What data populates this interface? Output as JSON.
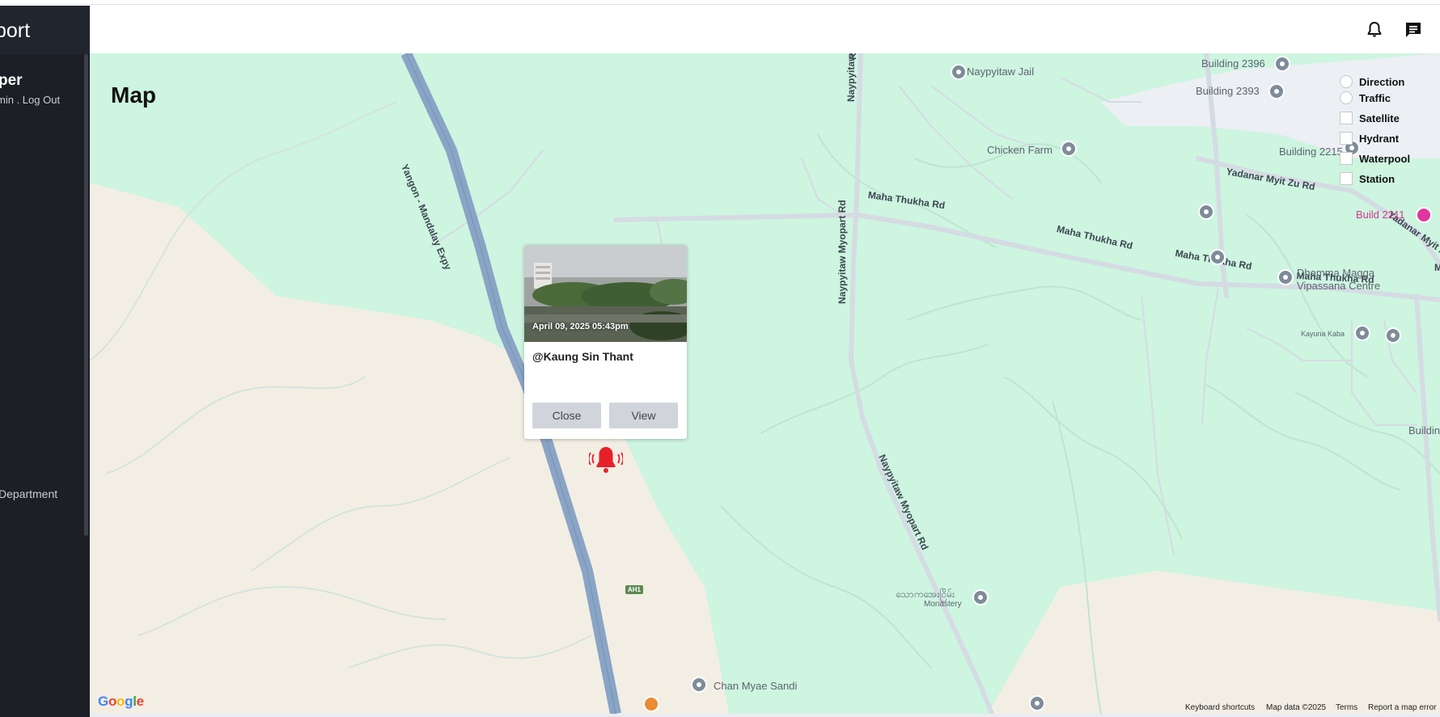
{
  "sidebar": {
    "brand": "port",
    "user_name": "per",
    "user_role": "min",
    "separator": " . ",
    "logout_label": "Log Out",
    "menu_item": "Department"
  },
  "header": {
    "notification_icon": "bell-icon",
    "messages_icon": "chat-icon"
  },
  "page": {
    "title": "Map"
  },
  "layers": [
    {
      "label": "Direction",
      "type": "radio",
      "checked": false
    },
    {
      "label": "Traffic",
      "type": "radio",
      "checked": false
    },
    {
      "label": "Satellite",
      "type": "checkbox",
      "checked": false
    },
    {
      "label": "Hydrant",
      "type": "checkbox",
      "checked": false
    },
    {
      "label": "Waterpool",
      "type": "checkbox",
      "checked": false
    },
    {
      "label": "Station",
      "type": "checkbox",
      "checked": false
    }
  ],
  "popup": {
    "timestamp": "April 09, 2025 05:43pm",
    "user": "@Kaung Sin Thant",
    "close_label": "Close",
    "view_label": "View"
  },
  "map_labels": {
    "jail": "Naypyitaw Jail",
    "b2396": "Building 2396",
    "b2393": "Building 2393",
    "b2215": "Building 2215",
    "chicken": "Chicken Farm",
    "build2211": "Build 2211",
    "dhamma_line1": "Dhamma Magga",
    "dhamma_line2": "Vipassana Centre",
    "kayuna": "Kayuna Kaba",
    "buildin": "Buildin",
    "monastery_mm": "သောကအေးငြိမ်း",
    "monastery": "Monastery",
    "chan": "Chan Myae Sandi",
    "road_yangon": "Yangon - Mandalay Expy",
    "road_myopart_top": "Naypyitaw Myopart Rd",
    "road_myopart_mid": "Naypyitaw Myopart Rd",
    "road_myopart_low": "Naypyitaw Myopart Rd",
    "road_rd_top": "Rd",
    "road_thukha1": "Maha Thukha Rd",
    "road_thukha2": "Maha Thukha Rd",
    "road_thukha3": "Maha Thukha Rd",
    "road_thukha4": "Maha Thukha Rd",
    "road_yadanar1": "Yadanar Myit Zu Rd",
    "road_yadanar2": "Yadanar Myit Zu Rd",
    "road_m": "M",
    "ah1": "AH1"
  },
  "footer": {
    "google": "Google",
    "shortcuts": "Keyboard shortcuts",
    "mapdata": "Map data ©2025",
    "terms": "Terms",
    "report": "Report a map error"
  },
  "colors": {
    "sidebar_bg": "#1c1f26",
    "map_green": "#cdf5e0",
    "map_beige": "#f3eee4",
    "highway": "#8aa4c5",
    "road": "#d5dbe3",
    "alarm_red": "#e8202a",
    "poi_pink": "#e0359f"
  }
}
